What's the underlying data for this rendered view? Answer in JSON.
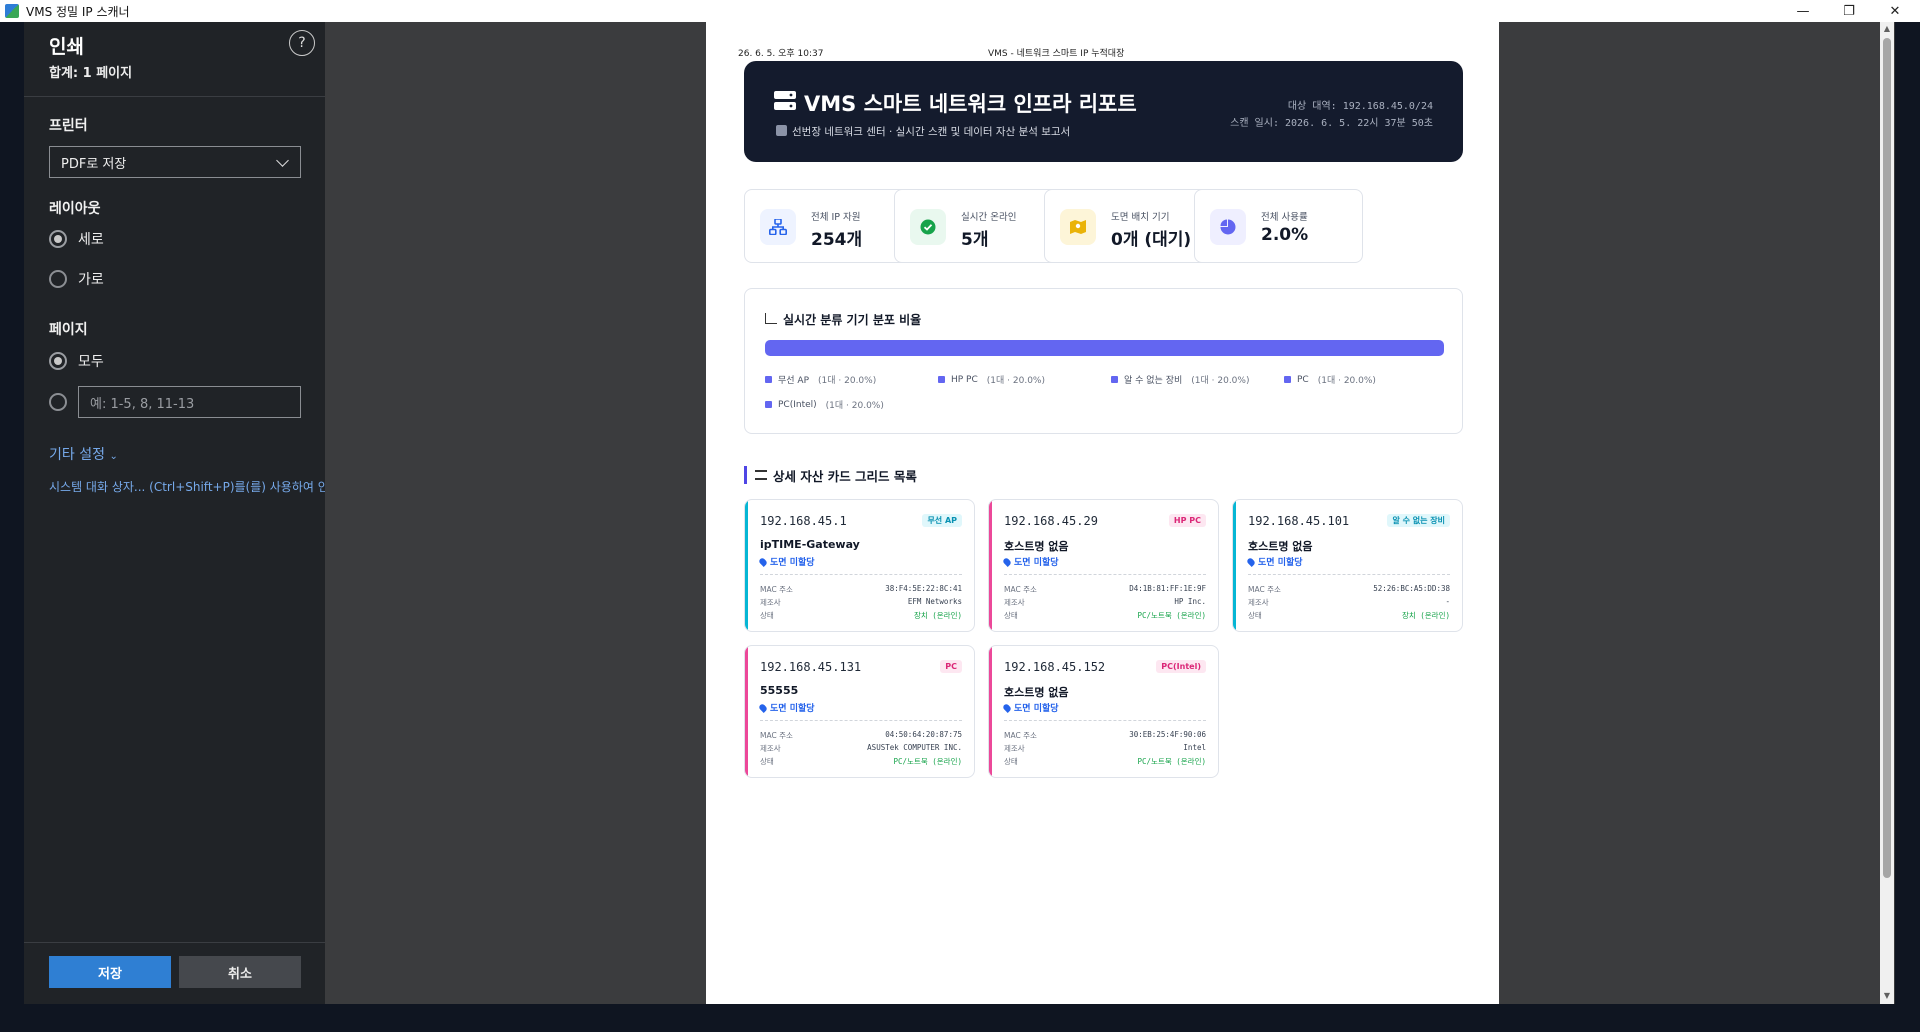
{
  "window": {
    "title": "VMS 정밀 IP 스캐너"
  },
  "print_panel": {
    "title": "인쇄",
    "page_count": "합계: 1 페이지",
    "printer_label": "프린터",
    "printer_value": "PDF로 저장",
    "layout_label": "레이아웃",
    "layout_options": [
      "세로",
      "가로"
    ],
    "layout_selected": "세로",
    "pages_label": "페이지",
    "pages_all": "모두",
    "pages_range_placeholder": "예: 1-5, 8, 11-13",
    "more_settings": "기타 설정",
    "system_dialog": "시스템 대화 상자... (Ctrl+Shift+P)를(를) 사용하여 인",
    "save_button": "저장",
    "cancel_button": "취소",
    "help": "?"
  },
  "page_header": {
    "datetime": "26. 6. 5. 오후 10:37",
    "doc_title": "VMS - 네트워크 스마트 IP 누적대장"
  },
  "report": {
    "title": "VMS 스마트 네트워크 인프라 리포트",
    "subtitle": "선번장 네트워크 센터 · 실시간 스캔 및 데이터 자산 분석 보고서",
    "target_range": "대상 대역: 192.168.45.0/24",
    "scan_time": "스캔 일시: 2026. 6. 5. 22시 37분 50초",
    "stats": [
      {
        "label": "전체 IP 자원",
        "value": "254개",
        "icon": "network-icon",
        "color": "#2563eb",
        "bg": "#eef3ff"
      },
      {
        "label": "실시간 온라인",
        "value": "5개",
        "icon": "check-circle-icon",
        "color": "#16a34a",
        "bg": "#e9f8ef"
      },
      {
        "label": "도면 배치 기기",
        "value": "0개 (대기)",
        "icon": "map-icon",
        "color": "#ca8a04",
        "bg": "#fdf5d8"
      },
      {
        "label": "전체 사용률",
        "value": "2.0%",
        "icon": "pie-chart-icon",
        "color": "#6366f1",
        "bg": "#efefff"
      }
    ],
    "distribution": {
      "title": "실시간 분류 기기 분포 비율",
      "bar_color": "#6366f1",
      "legend": [
        {
          "name": "무선 AP",
          "count": "(1대 · 20.0%)",
          "share": 0.2
        },
        {
          "name": "HP PC",
          "count": "(1대 · 20.0%)",
          "share": 0.2
        },
        {
          "name": "알 수 없는 장비",
          "count": "(1대 · 20.0%)",
          "share": 0.2
        },
        {
          "name": "PC",
          "count": "(1대 · 20.0%)",
          "share": 0.2
        },
        {
          "name": "PC(Intel)",
          "count": "(1대 · 20.0%)",
          "share": 0.2
        }
      ]
    },
    "grid_title": "상세 자산 카드 그리드 목록",
    "cards": [
      {
        "ip": "192.168.45.1",
        "tag": "무선 AP",
        "tag_color": "#0891b2",
        "tag_bg": "#e0f7fb",
        "accent": "#06b6d4",
        "host": "ipTIME-Gateway",
        "location": "도면 미할당",
        "mac_label": "MAC 주소",
        "mac": "38:F4:5E:22:8C:41",
        "vendor_label": "제조사",
        "vendor": "EFM Networks",
        "status_label": "상태",
        "status": "장치 (온라인)"
      },
      {
        "ip": "192.168.45.29",
        "tag": "HP PC",
        "tag_color": "#db2777",
        "tag_bg": "#fde7f1",
        "accent": "#ec4899",
        "host": "호스트명 없음",
        "location": "도면 미할당",
        "mac_label": "MAC 주소",
        "mac": "D4:1B:81:FF:1E:9F",
        "vendor_label": "제조사",
        "vendor": "HP Inc.",
        "status_label": "상태",
        "status": "PC/노트북 (온라인)"
      },
      {
        "ip": "192.168.45.101",
        "tag": "알 수 없는 장비",
        "tag_color": "#0891b2",
        "tag_bg": "#e0f7fb",
        "accent": "#06b6d4",
        "host": "호스트명 없음",
        "location": "도면 미할당",
        "mac_label": "MAC 주소",
        "mac": "52:26:BC:A5:DD:38",
        "vendor_label": "제조사",
        "vendor": "-",
        "status_label": "상태",
        "status": "장치 (온라인)"
      },
      {
        "ip": "192.168.45.131",
        "tag": "PC",
        "tag_color": "#db2777",
        "tag_bg": "#fde7f1",
        "accent": "#ec4899",
        "host": "55555",
        "location": "도면 미할당",
        "mac_label": "MAC 주소",
        "mac": "04:50:64:20:87:75",
        "vendor_label": "제조사",
        "vendor": "ASUSTek COMPUTER INC.",
        "status_label": "상태",
        "status": "PC/노트북 (온라인)"
      },
      {
        "ip": "192.168.45.152",
        "tag": "PC(Intel)",
        "tag_color": "#db2777",
        "tag_bg": "#fde7f1",
        "accent": "#ec4899",
        "host": "호스트명 없음",
        "location": "도면 미할당",
        "mac_label": "MAC 주소",
        "mac": "30:EB:25:4F:90:06",
        "vendor_label": "제조사",
        "vendor": "Intel",
        "status_label": "상태",
        "status": "PC/노트북 (온라인)"
      }
    ]
  }
}
